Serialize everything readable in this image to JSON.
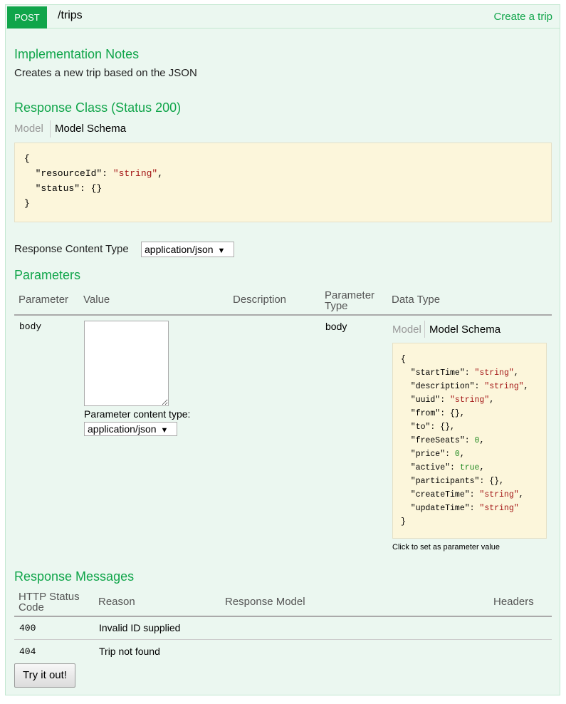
{
  "operation": {
    "method": "POST",
    "path": "/trips",
    "summary": "Create a trip"
  },
  "implementation_notes": {
    "title": "Implementation Notes",
    "text": "Creates a new trip based on the JSON"
  },
  "response_class": {
    "title": "Response Class (Status 200)",
    "tab_model": "Model",
    "tab_schema": "Model Schema",
    "schema_lines": [
      "{",
      "  \"resourceId\": \"string\",",
      "  \"status\": {}",
      "}"
    ]
  },
  "response_content_type": {
    "label": "Response Content Type",
    "selected": "application/json"
  },
  "parameters": {
    "title": "Parameters",
    "headers": {
      "parameter": "Parameter",
      "value": "Value",
      "description": "Description",
      "parameter_type_1": "Parameter",
      "parameter_type_2": "Type",
      "data_type": "Data Type"
    },
    "row": {
      "name": "body",
      "value": "",
      "content_type_label": "Parameter content type:",
      "content_type_selected": "application/json",
      "param_type": "body",
      "tab_model": "Model",
      "tab_schema": "Model Schema",
      "schema_hint": "Click to set as parameter value"
    },
    "schema_lines": [
      "{",
      "  \"startTime\": \"string\",",
      "  \"description\": \"string\",",
      "  \"uuid\": \"string\",",
      "  \"from\": {},",
      "  \"to\": {},",
      "  \"freeSeats\": 0,",
      "  \"price\": 0,",
      "  \"active\": true,",
      "  \"participants\": {},",
      "  \"createTime\": \"string\",",
      "  \"updateTime\": \"string\"",
      "}"
    ]
  },
  "response_messages": {
    "title": "Response Messages",
    "headers": {
      "status_1": "HTTP Status",
      "status_2": "Code",
      "reason": "Reason",
      "model": "Response Model",
      "headers": "Headers"
    },
    "rows": [
      {
        "code": "400",
        "reason": "Invalid ID supplied"
      },
      {
        "code": "404",
        "reason": "Trip not found"
      }
    ]
  },
  "try_button": "Try it out!",
  "colors": {
    "accent": "#10a54a",
    "panel_bg": "#ebf7f0",
    "code_bg": "#fcf6db"
  }
}
